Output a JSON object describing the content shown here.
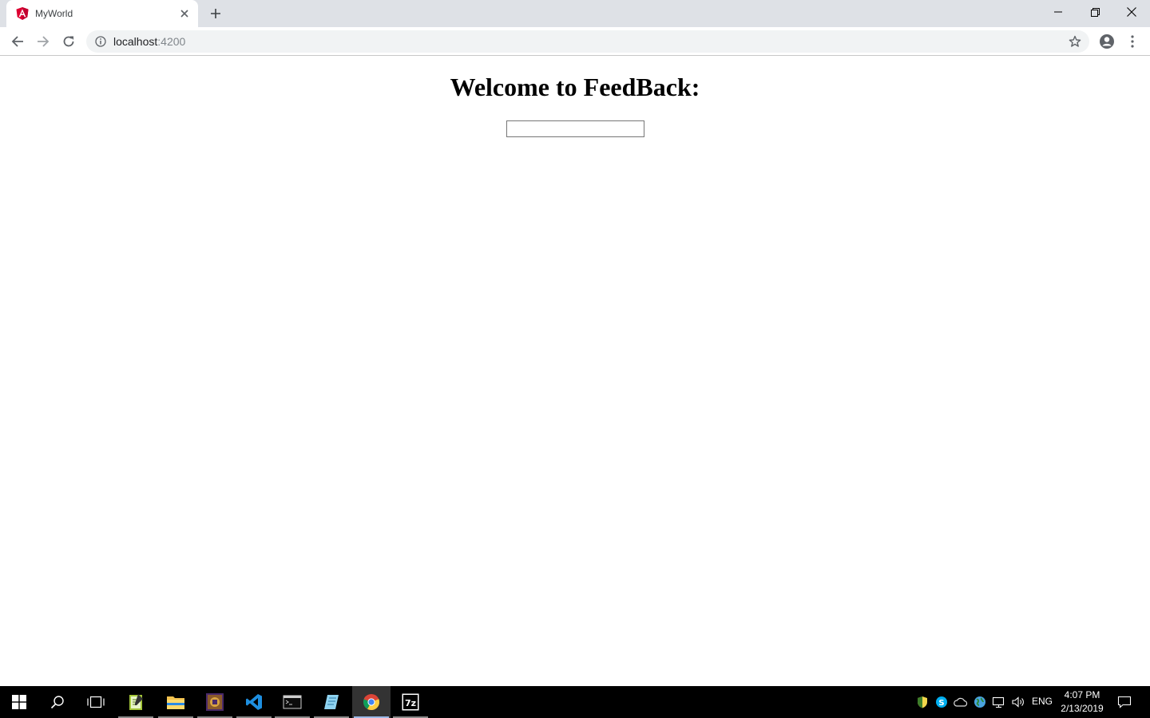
{
  "browser": {
    "tab": {
      "title": "MyWorld",
      "favicon": "angular-icon"
    },
    "new_tab_icon": "plus-icon",
    "window_controls": [
      "minimize-icon",
      "restore-icon",
      "close-icon"
    ],
    "url_host": "localhost",
    "url_port": ":4200"
  },
  "page": {
    "heading": "Welcome to FeedBack:",
    "feedback_input": {
      "value": "",
      "placeholder": ""
    }
  },
  "taskbar": {
    "apps": [
      "notepad-plus-plus-icon",
      "file-explorer-icon",
      "game-app-icon",
      "vscode-icon",
      "terminal-icon",
      "notepad-icon",
      "chrome-icon",
      "7zip-icon"
    ],
    "active_app": "chrome-icon",
    "tray": [
      "defender-icon",
      "skype-icon",
      "onedrive-icon",
      "network-globe-icon",
      "wifi-icon",
      "volume-icon"
    ],
    "language": "ENG",
    "time": "4:07 PM",
    "date": "2/13/2019"
  },
  "colors": {
    "tabstrip": "#dee1e6",
    "omnibox": "#f1f3f4",
    "angular_red": "#dd0031",
    "taskbar": "#000000"
  }
}
